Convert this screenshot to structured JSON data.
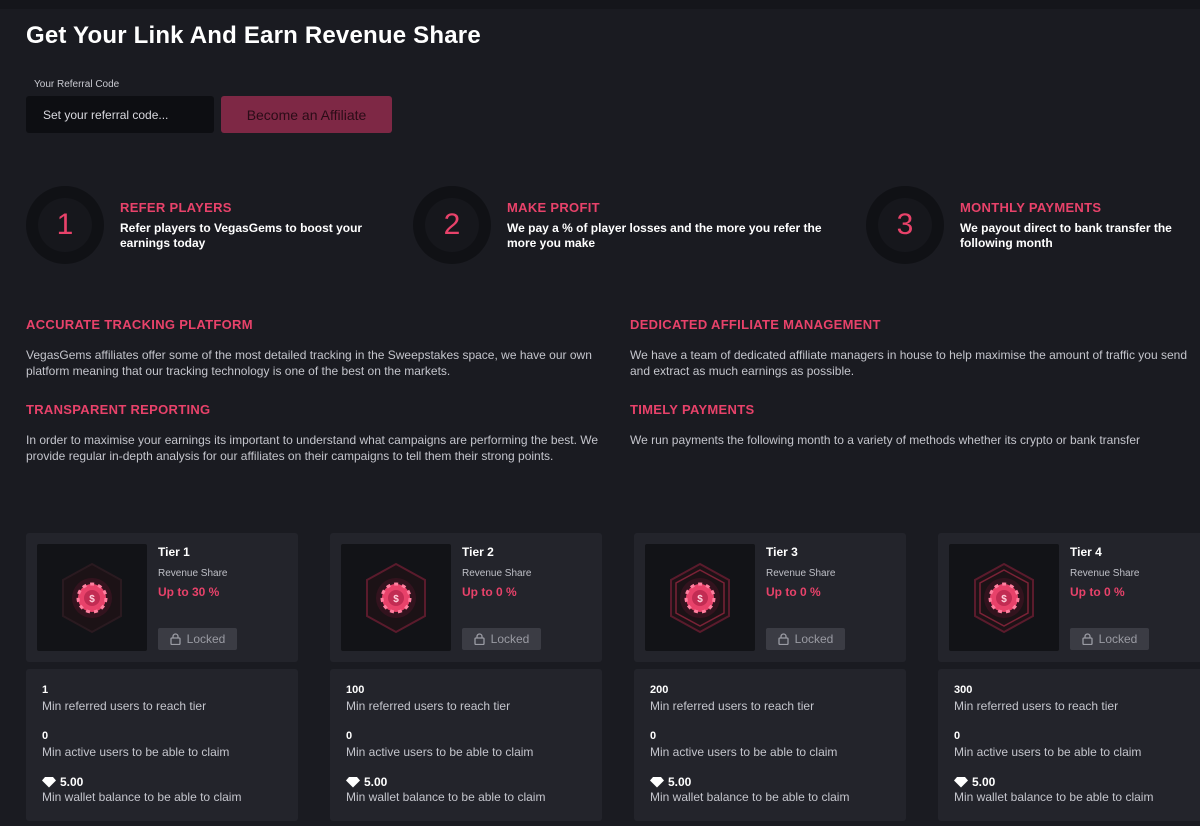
{
  "header": {
    "title": "Get Your Link And Earn Revenue Share"
  },
  "referral": {
    "label": "Your Referral Code",
    "placeholder": "Set your referral code...",
    "button_label": "Become an Affiliate"
  },
  "steps": [
    {
      "number": "1",
      "title": "REFER PLAYERS",
      "text": "Refer players to VegasGems to boost your earnings today"
    },
    {
      "number": "2",
      "title": "MAKE PROFIT",
      "text": "We pay a % of player losses and the more you refer the more you make"
    },
    {
      "number": "3",
      "title": "MONTHLY PAYMENTS",
      "text": "We payout direct to bank transfer the following month"
    }
  ],
  "features": [
    {
      "title": "ACCURATE TRACKING PLATFORM",
      "text": "VegasGems affiliates offer some of the most detailed tracking in the Sweepstakes space, we have our own platform meaning that our tracking technology is one of the best on the markets."
    },
    {
      "title": "DEDICATED AFFILIATE MANAGEMENT",
      "text": "We have a team of dedicated affiliate managers in house to help maximise the amount of traffic you send and extract as much earnings as possible."
    },
    {
      "title": "TRANSPARENT REPORTING",
      "text": "In order to maximise your earnings its important to understand what campaigns are performing the best. We provide regular in-depth analysis for our affiliates on their campaigns to tell them their strong points."
    },
    {
      "title": "TIMELY PAYMENTS",
      "text": "We run payments the following month to a variety of methods whether its crypto or bank transfer"
    }
  ],
  "tiers": [
    {
      "name": "Tier 1",
      "sub": "Revenue Share",
      "share": "Up to 30 %",
      "lock": "Locked",
      "min_referred": "1",
      "min_referred_label": "Min referred users to reach tier",
      "min_active": "0",
      "min_active_label": "Min active users to be able to claim",
      "min_balance": "5.00",
      "min_balance_label": "Min wallet balance to be able to claim"
    },
    {
      "name": "Tier 2",
      "sub": "Revenue Share",
      "share": "Up to 0 %",
      "lock": "Locked",
      "min_referred": "100",
      "min_referred_label": "Min referred users to reach tier",
      "min_active": "0",
      "min_active_label": "Min active users to be able to claim",
      "min_balance": "5.00",
      "min_balance_label": "Min wallet balance to be able to claim"
    },
    {
      "name": "Tier 3",
      "sub": "Revenue Share",
      "share": "Up to 0 %",
      "lock": "Locked",
      "min_referred": "200",
      "min_referred_label": "Min referred users to reach tier",
      "min_active": "0",
      "min_active_label": "Min active users to be able to claim",
      "min_balance": "5.00",
      "min_balance_label": "Min wallet balance to be able to claim"
    },
    {
      "name": "Tier 4",
      "sub": "Revenue Share",
      "share": "Up to 0 %",
      "lock": "Locked",
      "min_referred": "300",
      "min_referred_label": "Min referred users to reach tier",
      "min_active": "0",
      "min_active_label": "Min active users to be able to claim",
      "min_balance": "5.00",
      "min_balance_label": "Min wallet balance to be able to claim"
    }
  ],
  "icons": {
    "tier_badge": "chip-badge-icon",
    "lock": "lock-icon",
    "gem": "gem-icon"
  },
  "colors": {
    "accent": "#e8426a",
    "button": "#7e2845",
    "background": "#1a1b21",
    "card": "#23242b"
  }
}
